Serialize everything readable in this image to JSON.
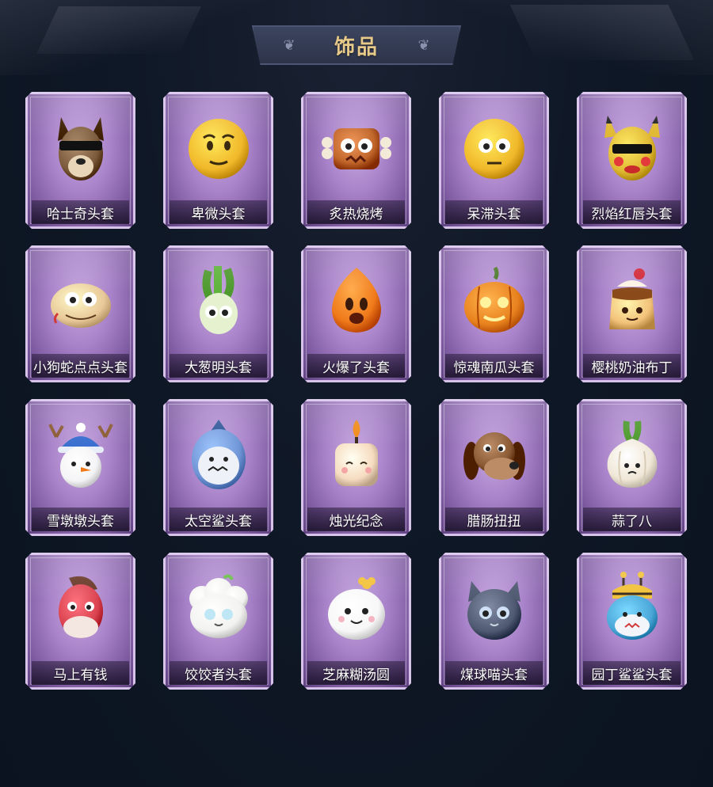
{
  "header": {
    "title": "饰品"
  },
  "items": [
    {
      "label": "哈士奇头套",
      "icon": "husky-dog-head-icon",
      "color": "#7a5a3a"
    },
    {
      "label": "卑微头套",
      "icon": "worried-emoji-head-icon",
      "color": "#f0b82a"
    },
    {
      "label": "炙热烧烤",
      "icon": "grilled-meat-head-icon",
      "color": "#c0662a"
    },
    {
      "label": "呆滞头套",
      "icon": "blank-stare-emoji-head-icon",
      "color": "#f0b82a"
    },
    {
      "label": "烈焰红唇头套",
      "icon": "yellow-mouse-sunglasses-head-icon",
      "color": "#e0b832"
    },
    {
      "label": "小狗蛇点点头套",
      "icon": "snake-head-icon",
      "color": "#e8c898"
    },
    {
      "label": "大葱明头套",
      "icon": "green-onion-head-icon",
      "color": "#7bbf4a"
    },
    {
      "label": "火爆了头套",
      "icon": "fireball-head-icon",
      "color": "#f07a1a"
    },
    {
      "label": "惊魂南瓜头套",
      "icon": "pumpkin-head-icon",
      "color": "#e8821e"
    },
    {
      "label": "樱桃奶油布丁",
      "icon": "cherry-pudding-head-icon",
      "color": "#f2c27a"
    },
    {
      "label": "雪墩墩头套",
      "icon": "snowman-head-icon",
      "color": "#f4f4f6"
    },
    {
      "label": "太空鲨头套",
      "icon": "space-shark-head-icon",
      "color": "#6f95d6"
    },
    {
      "label": "烛光纪念",
      "icon": "candle-head-icon",
      "color": "#f6dcc0"
    },
    {
      "label": "腊肠扭扭",
      "icon": "dachshund-head-icon",
      "color": "#8a5a34"
    },
    {
      "label": "蒜了八",
      "icon": "garlic-head-icon",
      "color": "#efe6d6"
    },
    {
      "label": "马上有钱",
      "icon": "red-horse-head-icon",
      "color": "#d9424e"
    },
    {
      "label": "饺饺者头套",
      "icon": "dumpling-head-icon",
      "color": "#f2f2f0"
    },
    {
      "label": "芝麻糊汤圆",
      "icon": "rice-ball-head-icon",
      "color": "#f7f7f7"
    },
    {
      "label": "煤球喵头套",
      "icon": "grey-cat-head-icon",
      "color": "#4f5a72"
    },
    {
      "label": "园丁鲨鲨头套",
      "icon": "gardener-shark-head-icon",
      "color": "#4aa7d8"
    }
  ]
}
